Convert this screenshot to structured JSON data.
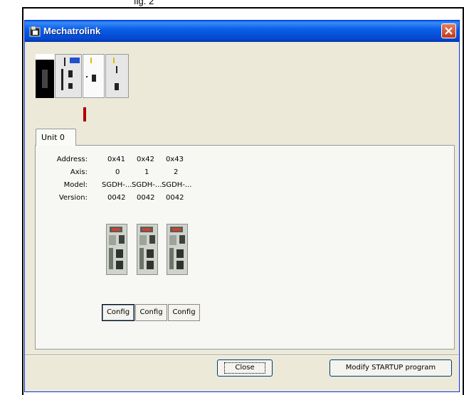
{
  "caption": "fig. 2",
  "window": {
    "title": "Mechatrolink",
    "colors": {
      "titlebar": "#0a5ee8",
      "close": "#c2371a",
      "marker": "#b00000"
    }
  },
  "tabs": [
    {
      "label": "Unit 0"
    }
  ],
  "details": {
    "labels": {
      "address": "Address:",
      "axis": "Axis:",
      "model": "Model:",
      "version": "Version:"
    },
    "units": [
      {
        "address": "0x41",
        "axis": "0",
        "model": "SGDH-...",
        "version": "0042",
        "config_label": "Config"
      },
      {
        "address": "0x42",
        "axis": "1",
        "model": "SGDH-...",
        "version": "0042",
        "config_label": "Config"
      },
      {
        "address": "0x43",
        "axis": "2",
        "model": "SGDH-...",
        "version": "0042",
        "config_label": "Config"
      }
    ]
  },
  "footer": {
    "close_label": "Close",
    "modify_label": "Modify STARTUP program"
  },
  "icons": [
    "mechatrolink-app-icon",
    "close-icon",
    "servo-drive-image",
    "rack-image"
  ]
}
